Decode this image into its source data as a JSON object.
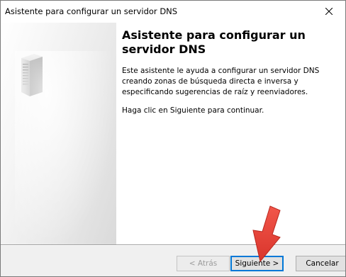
{
  "window": {
    "title": "Asistente para configurar un servidor DNS"
  },
  "title_bar": {
    "close_icon": "close-icon"
  },
  "side_panel": {
    "icon": "server-icon"
  },
  "content": {
    "heading": "Asistente para configurar un servidor DNS",
    "paragraph_1": "Este asistente le ayuda a configurar un servidor DNS creando zonas de búsqueda directa e inversa y especificando sugerencias de raíz y reenviadores.",
    "paragraph_2": "Haga clic en Siguiente para continuar."
  },
  "buttons": {
    "back_label": "< Atrás",
    "next_label": "Siguiente >",
    "cancel_label": "Cancelar"
  },
  "colors": {
    "focus_border": "#0078d7",
    "annotation_arrow": "#e8433a"
  },
  "annotation": {
    "arrow_icon": "red-arrow-icon"
  }
}
